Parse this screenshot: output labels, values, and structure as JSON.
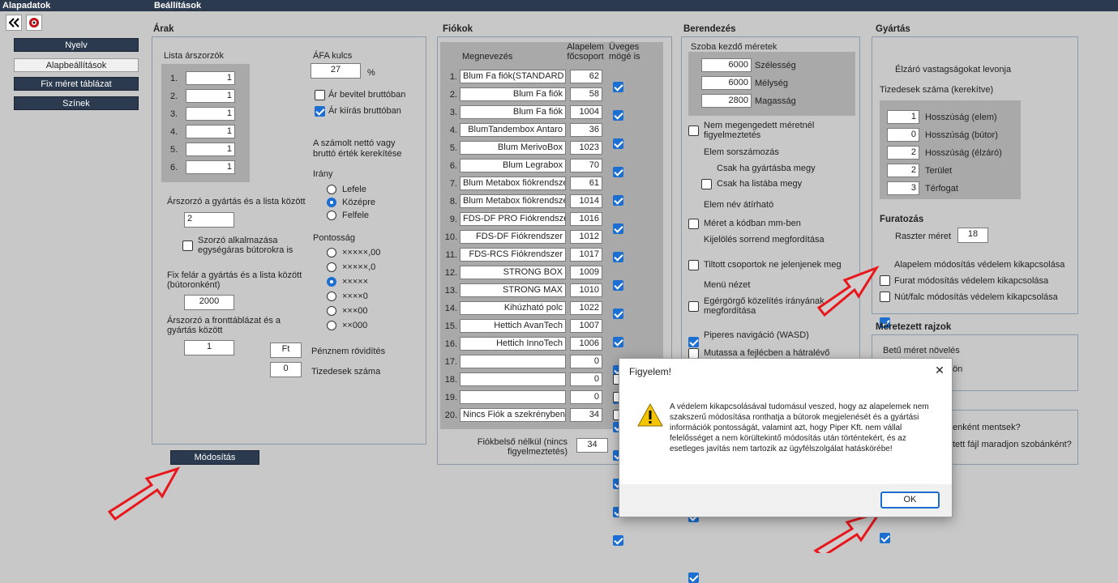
{
  "topbar": {
    "left": "Alapadatok",
    "right": "Beállítások"
  },
  "nav": [
    "Nyelv",
    "Alapbeállítások",
    "Fix méret táblázat",
    "Színek"
  ],
  "arak": {
    "title": "Árak",
    "lista_title": "Lista árszorzók",
    "lista": [
      {
        "n": "1.",
        "v": "1"
      },
      {
        "n": "2.",
        "v": "1"
      },
      {
        "n": "3.",
        "v": "1"
      },
      {
        "n": "4.",
        "v": "1"
      },
      {
        "n": "5.",
        "v": "1"
      },
      {
        "n": "6.",
        "v": "1"
      }
    ],
    "afa_label": "ÁFA kulcs",
    "afa_value": "27",
    "afa_unit": "%",
    "ar_bevitel": "Ár bevitel bruttóban",
    "ar_kiiras": "Ár kiírás bruttóban",
    "kerekites": "A számolt nettó vagy bruttó érték kerekítése",
    "irany": "Irány",
    "irany_opts": [
      "Lefele",
      "Középre",
      "Felfele"
    ],
    "pontossag": "Pontosság",
    "pontossag_opts": [
      "×××××,00",
      "×××××,0",
      "×××××",
      "××××0",
      "×××00",
      "××000"
    ],
    "arszorzo_label": "Árszorzó a gyártás és a lista között",
    "arszorzo_value": "2",
    "szorzo_alk": "Szorzó alkalmazása egységáras bútorokra is",
    "fix_felar_label": "Fix felár a gyártás és a lista között (bútoronként)",
    "fix_felar_value": "2000",
    "front_label": "Árszorzó a fronttáblázat és a gyártás között",
    "front_value": "1",
    "penznem_value": "Ft",
    "penznem_label": "Pénznem rövidítés",
    "tizedes_value": "0",
    "tizedes_label": "Tizedesek száma",
    "modositas": "Módosítás"
  },
  "fiokok": {
    "title": "Fiókok",
    "col_name": "Megnevezés",
    "col_alap": "Alapelem főcsoport",
    "col_uveges": "Üveges mögé is",
    "rows": [
      {
        "n": "1.",
        "name": "Blum Fa fiók(STANDARD",
        "v": "62",
        "c": true
      },
      {
        "n": "2.",
        "name": "Blum Fa fiók",
        "v": "58",
        "c": true
      },
      {
        "n": "3.",
        "name": "Blum Fa fiók",
        "v": "1004",
        "c": true
      },
      {
        "n": "4.",
        "name": "BlumTandembox Antaro",
        "v": "36",
        "c": true
      },
      {
        "n": "5.",
        "name": "Blum MerivoBox",
        "v": "1023",
        "c": true
      },
      {
        "n": "6.",
        "name": "Blum Legrabox",
        "v": "70",
        "c": true
      },
      {
        "n": "7.",
        "name": "Blum Metabox fiókrendszer",
        "v": "61",
        "c": true
      },
      {
        "n": "8.",
        "name": "Blum Metabox fiókrendszer",
        "v": "1014",
        "c": true
      },
      {
        "n": "9.",
        "name": "FDS-DF PRO Fiókrendszer",
        "v": "1016",
        "c": true
      },
      {
        "n": "10.",
        "name": "FDS-DF Fiókrendszer",
        "v": "1012",
        "c": true
      },
      {
        "n": "11.",
        "name": "FDS-RCS Fiókrendszer",
        "v": "1017",
        "c": true
      },
      {
        "n": "12.",
        "name": "STRONG BOX",
        "v": "1009",
        "c": true
      },
      {
        "n": "13.",
        "name": "STRONG MAX",
        "v": "1010",
        "c": true
      },
      {
        "n": "14.",
        "name": "Kihúzható polc",
        "v": "1022",
        "c": true
      },
      {
        "n": "15.",
        "name": "Hettich AvanTech",
        "v": "1007",
        "c": true
      },
      {
        "n": "16.",
        "name": "Hettich InnoTech",
        "v": "1006",
        "c": true
      },
      {
        "n": "17.",
        "name": "",
        "v": "0",
        "c": true
      },
      {
        "n": "18.",
        "name": "",
        "v": "0",
        "c": false
      },
      {
        "n": "19.",
        "name": "",
        "v": "0",
        "c": false
      },
      {
        "n": "20.",
        "name": "Nincs Fiók a szekrényben",
        "v": "34",
        "c": false
      }
    ],
    "fiokbelso_label": "Fiókbelső nélkül (nincs figyelmeztetés)",
    "fiokbelso_value": "34"
  },
  "berendezes": {
    "title": "Berendezés",
    "szoba": "Szoba kezdő méretek",
    "meretek": [
      {
        "v": "6000",
        "l": "Szélesség"
      },
      {
        "v": "6000",
        "l": "Mélység"
      },
      {
        "v": "2800",
        "l": "Magasság"
      }
    ],
    "opts": [
      {
        "l": "Nem megengedett méretnél figyelmeztetés",
        "c": false
      },
      {
        "l": "Elem sorszámozás",
        "c": true
      },
      {
        "l": "Csak ha gyártásba megy",
        "c": true
      },
      {
        "l": "Csak ha listába megy",
        "c": false
      },
      {
        "l": "Elem név átírható",
        "c": true
      },
      {
        "l": "Méret a kódban mm-ben",
        "c": false
      },
      {
        "l": "Kijelölés sorrend megfordítása",
        "c": true
      },
      {
        "l": "Tiltott csoportok ne jelenjenek meg",
        "c": false
      },
      {
        "l": "Menü nézet",
        "c": true
      },
      {
        "l": "Egérgörgő közelítés irányának megfordítása",
        "c": false
      },
      {
        "l": "Piperes navigáció (WASD)",
        "c": true
      },
      {
        "l": "Mutassa a fejlécben a hátralévő",
        "c": false
      }
    ]
  },
  "gyartas": {
    "title": "Gyártás",
    "elzaro": "Élzáró vastagságokat levonja",
    "tizedes_title": "Tizedesek száma (kerekítve)",
    "tizedes": [
      {
        "v": "1",
        "l": "Hosszúság (elem)"
      },
      {
        "v": "0",
        "l": "Hosszúság (bútor)"
      },
      {
        "v": "2",
        "l": "Hosszúság (élzáró)"
      },
      {
        "v": "2",
        "l": "Terület"
      },
      {
        "v": "3",
        "l": "Térfogat"
      }
    ],
    "furatozas": "Furatozás",
    "raszter": "Raszter méret",
    "raszter_value": "18",
    "vedelem": [
      {
        "l": "Alapelem módosítás védelem kikapcsolása",
        "c": true
      },
      {
        "l": "Furat módosítás védelem kikapcsolása",
        "c": false
      },
      {
        "l": "Nút/falc módosítás védelem kikapcsolása",
        "c": false
      }
    ]
  },
  "rajzok": {
    "title": "Méretezett rajzok",
    "betu": "Betű méret növelés",
    "betu_tail": "ön"
  },
  "mentes": {
    "line1": "enként mentsek?",
    "line2": "tett fájl maradjon szobánként?"
  },
  "dialog": {
    "title": "Figyelem!",
    "message": "A védelem kikapcsolásával tudomásul veszed, hogy az alapelemek nem szakszerű módosítása ronthatja a bútorok megjelenését és a gyártási információk pontosságát, valamint azt, hogy Piper Kft. nem vállal felelősséget a nem körültekintő módosítás után történtekért, és az esetleges javítás nem tartozik az ügyfélszolgálat hatáskörébe!",
    "ok": "OK",
    "close": "✕"
  },
  "colors": {
    "dark": "#2b3a4e",
    "accent": "#1c6fd1",
    "arrow": "#e8171b",
    "bg": "#c8c8c8"
  }
}
